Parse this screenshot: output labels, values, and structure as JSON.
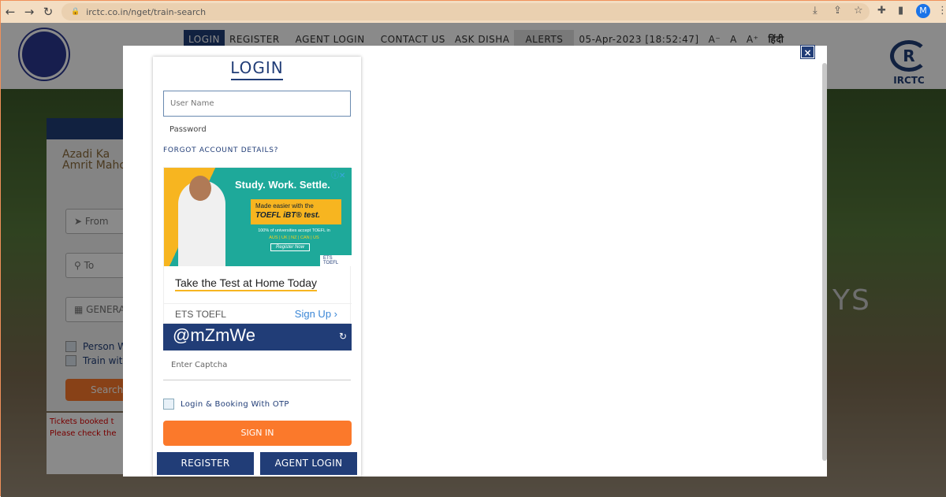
{
  "browser": {
    "url": "irctc.co.in/nget/train-search",
    "profile_initial": "M",
    "icons": [
      "back-icon",
      "forward-icon",
      "reload-icon",
      "lock-icon",
      "download-icon",
      "share-icon",
      "star-icon",
      "extensions-icon",
      "sidebar-icon",
      "menu-icon"
    ]
  },
  "header": {
    "menu": [
      "LOGIN",
      "REGISTER",
      "AGENT LOGIN",
      "CONTACT US",
      "ASK DISHA",
      "ALERTS"
    ],
    "datetime": "05-Apr-2023 [18:52:47]",
    "font_small": "A⁻",
    "font_normal": "A",
    "font_large": "A⁺",
    "language": "हिंदी",
    "logo_right": "IRCTC"
  },
  "background_form": {
    "azadi_line1": "Azadi Ka",
    "azadi_line2": "Amrit Mahot",
    "from": "From",
    "to": "To",
    "class": "GENERA",
    "person_checkbox": "Person W",
    "train_checkbox": "Train wit",
    "search": "Search",
    "notice1": "Tickets booked t",
    "notice2": "Please check the",
    "hero_text": "YS"
  },
  "login": {
    "close": "×",
    "title": "LOGIN",
    "username_placeholder": "User Name",
    "password_placeholder": "Password",
    "forgot": "FORGOT ACCOUNT DETAILS?",
    "ad": {
      "headline": "Study. Work. Settle.",
      "tag1": "Made easier with the",
      "tag2": "TOEFL iBT® test.",
      "small1": "100% of universities accept TOEFL in",
      "small2": "AUS | UK | NZ | CAN | US",
      "register_now": "Register Now",
      "ets_logo": "ETS TOEFL",
      "title": "Take the Test at Home Today",
      "advertiser": "ETS TOEFL",
      "cta": "Sign Up ›",
      "info": "ⓘ✕"
    },
    "captcha_text": "@mZmWe",
    "captcha_refresh": "↻",
    "captcha_placeholder": "Enter Captcha",
    "otp_label": "Login & Booking With OTP",
    "signin": "SIGN IN",
    "register": "REGISTER",
    "agent_login": "AGENT LOGIN"
  },
  "colors": {
    "navy": "#213d77",
    "orange": "#fb792b"
  }
}
